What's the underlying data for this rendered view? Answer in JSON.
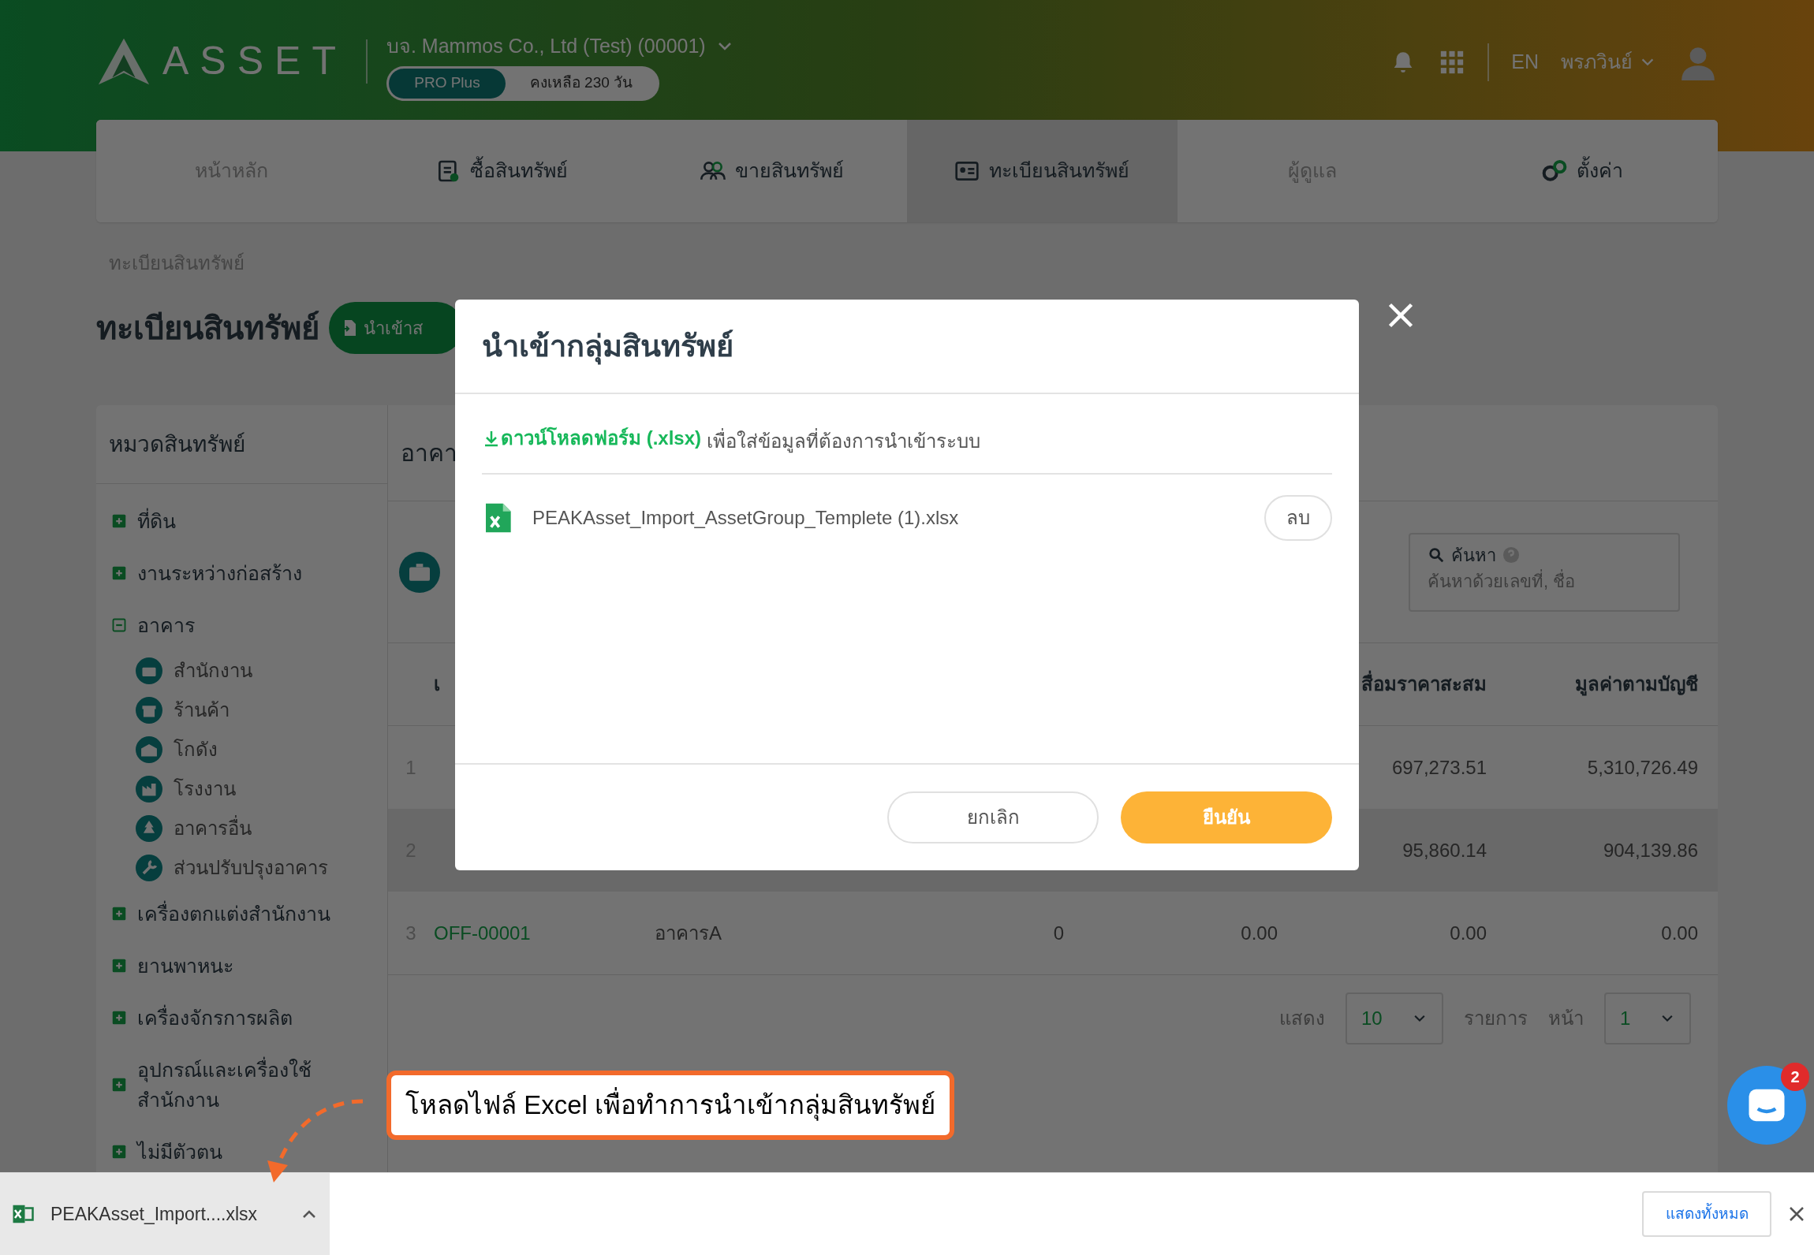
{
  "header": {
    "logo": "ASSET",
    "company": "บจ. Mammos Co., Ltd (Test) (00001)",
    "plan": "PRO Plus",
    "remaining": "คงเหลือ 230 วัน",
    "language": "EN",
    "user": "พรภวินย์"
  },
  "nav_tabs": [
    {
      "label": "หน้าหลัก",
      "selected": false,
      "disabled": true
    },
    {
      "label": "ซื้อสินทรัพย์",
      "selected": false,
      "disabled": false
    },
    {
      "label": "ขายสินทรัพย์",
      "selected": false,
      "disabled": false
    },
    {
      "label": "ทะเบียนสินทรัพย์",
      "selected": true,
      "disabled": false
    },
    {
      "label": "ผู้ดูแล",
      "selected": false,
      "disabled": true
    },
    {
      "label": "ตั้งค่า",
      "selected": false,
      "disabled": false
    }
  ],
  "breadcrumb": "ทะเบียนสินทรัพย์",
  "page_title": "ทะเบียนสินทรัพย์",
  "import_button": "นำเข้าส",
  "sidebar": {
    "title": "หมวดสินทรัพย์",
    "items": [
      {
        "label": "ที่ดิน",
        "expanded": false
      },
      {
        "label": "งานระหว่างก่อสร้าง",
        "expanded": false
      },
      {
        "label": "อาคาร",
        "expanded": true,
        "children": [
          {
            "label": "สำนักงาน"
          },
          {
            "label": "ร้านค้า"
          },
          {
            "label": "โกดัง"
          },
          {
            "label": "โรงงาน"
          },
          {
            "label": "อาคารอื่น"
          },
          {
            "label": "ส่วนปรับปรุงอาคาร"
          }
        ]
      },
      {
        "label": "เครื่องตกแต่งสำนักงาน",
        "expanded": false
      },
      {
        "label": "ยานพาหนะ",
        "expanded": false
      },
      {
        "label": "เครื่องจักรการผลิต",
        "expanded": false
      },
      {
        "label": "อุปกรณ์และเครื่องใช้สำนักงาน",
        "expanded": false
      },
      {
        "label": "ไม่มีตัวตน",
        "expanded": false
      }
    ]
  },
  "content": {
    "title": "อาคา",
    "search": {
      "label": "ค้นหา",
      "placeholder": "ค้นหาด้วยเลขที่, ชื่อ"
    },
    "table": {
      "headers": {
        "code": "เ",
        "accumulated_depreciation": "สื่อมราคาสะสม",
        "book_value": "มูลค่าตามบัญชี"
      },
      "rows": [
        {
          "no": "1",
          "accumulated_depreciation": "697,273.51",
          "book_value": "5,310,726.49"
        },
        {
          "no": "2",
          "accumulated_depreciation": "95,860.14",
          "book_value": "904,139.86"
        },
        {
          "no": "3",
          "code": "OFF-00001",
          "name": "อาคารA",
          "column_4": "0",
          "column_5": "0.00",
          "accumulated_depreciation": "0.00",
          "book_value": "0.00"
        }
      ]
    },
    "pagination": {
      "show_label": "แสดง",
      "page_size": "10",
      "items_label": "รายการ",
      "page_label": "หน้า",
      "page": "1"
    }
  },
  "modal": {
    "title": "นำเข้ากลุ่มสินทรัพย์",
    "download_link": "ดาวน์โหลดฟอร์ม (.xlsx)",
    "instruction": "เพื่อใส่ข้อมูลที่ต้องการนำเข้าระบบ",
    "file_name": "PEAKAsset_Import_AssetGroup_Templete (1).xlsx",
    "delete_button": "ลบ",
    "cancel_button": "ยกเลิก",
    "confirm_button": "ยืนยัน"
  },
  "callout": "โหลดไฟล์ Excel เพื่อทำการนำเข้ากลุ่มสินทรัพย์",
  "chat": {
    "badge": "2"
  },
  "download_bar": {
    "file": "PEAKAsset_Import....xlsx",
    "show_all": "แสดงทั้งหมด"
  }
}
